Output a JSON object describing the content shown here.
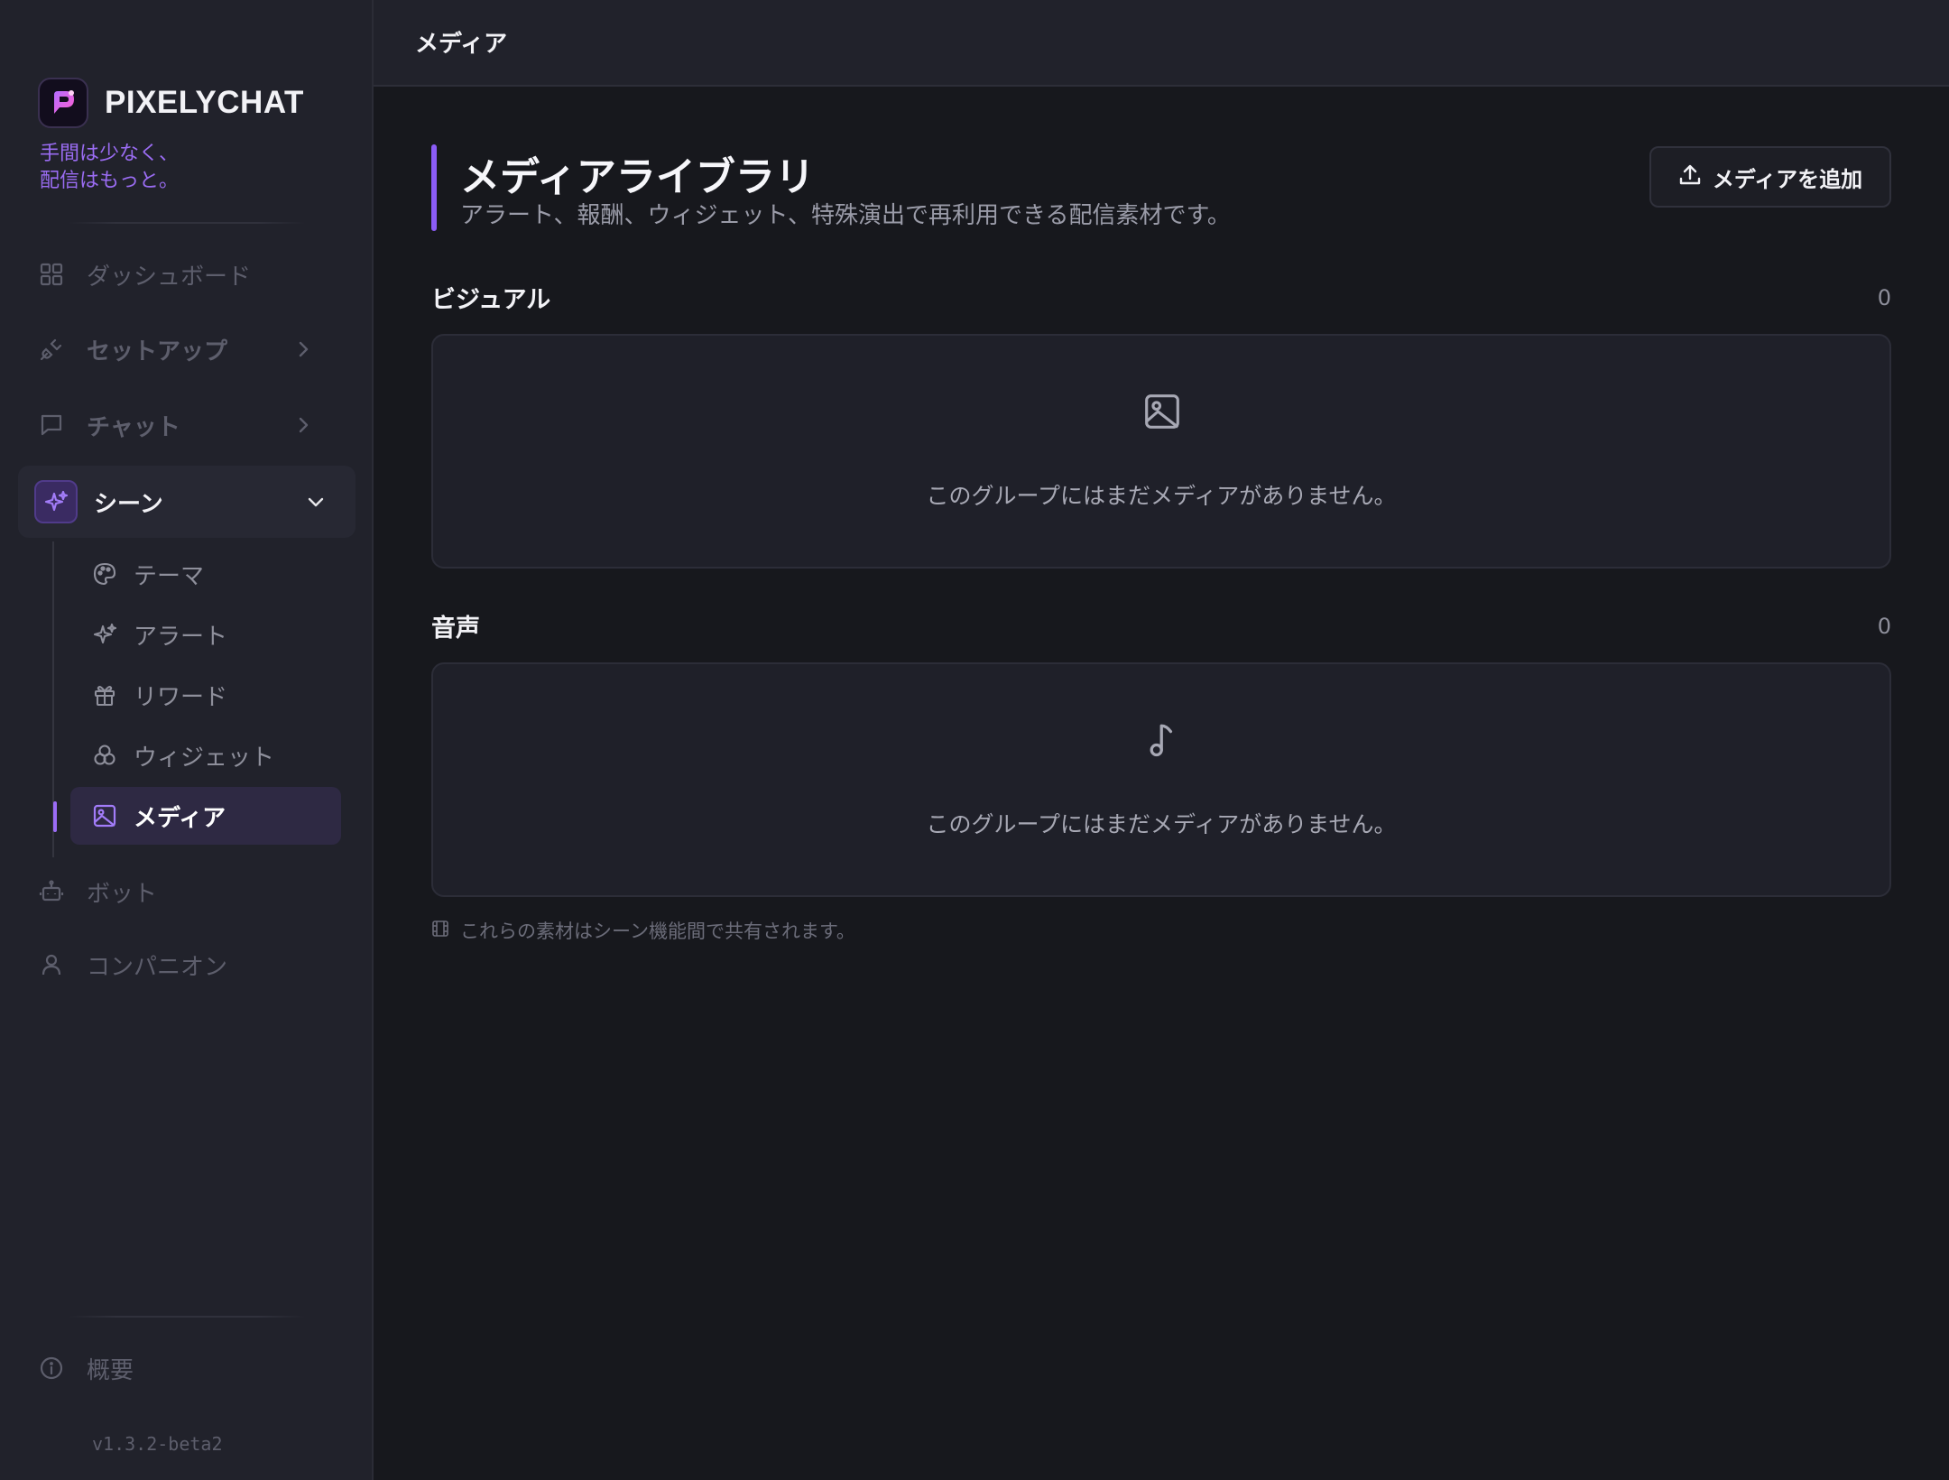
{
  "brand": {
    "name": "PIXELYCHAT",
    "tagline_line1": "手間は少なく、",
    "tagline_line2": "配信はもっと。"
  },
  "sidebar": {
    "items": [
      {
        "label": "ダッシュボード",
        "icon": "dashboard-grid-icon"
      },
      {
        "label": "セットアップ",
        "icon": "plug-icon",
        "has_children": true
      },
      {
        "label": "チャット",
        "icon": "chat-bubble-icon",
        "has_children": true
      },
      {
        "label": "シーン",
        "icon": "sparkles-icon",
        "expanded": true
      }
    ],
    "scene_children": [
      {
        "label": "テーマ",
        "icon": "palette-icon"
      },
      {
        "label": "アラート",
        "icon": "sparkles-icon"
      },
      {
        "label": "リワード",
        "icon": "gift-icon"
      },
      {
        "label": "ウィジェット",
        "icon": "widgets-icon"
      },
      {
        "label": "メディア",
        "icon": "image-icon",
        "active": true
      }
    ],
    "after_items": [
      {
        "label": "ボット",
        "icon": "bot-icon"
      },
      {
        "label": "コンパニオン",
        "icon": "user-icon"
      }
    ],
    "about": {
      "label": "概要",
      "icon": "info-icon"
    },
    "version": "v1.3.2-beta2"
  },
  "topbar": {
    "title": "メディア"
  },
  "page": {
    "title": "メディアライブラリ",
    "subtitle": "アラート、報酬、ウィジェット、特殊演出で再利用できる配信素材です。",
    "add_button": "メディアを追加"
  },
  "sections": [
    {
      "title": "ビジュアル",
      "count": "0",
      "empty_message": "このグループにはまだメディアがありません。",
      "icon": "image-icon"
    },
    {
      "title": "音声",
      "count": "0",
      "empty_message": "このグループにはまだメディアがありません。",
      "icon": "music-note-icon"
    }
  ],
  "footnote": "これらの素材はシーン機能間で共有されます。",
  "colors": {
    "accent": "#8b5cf6",
    "tagline": "#9a6cf2",
    "sidebar_bg": "#21222b",
    "main_bg": "#17181d"
  }
}
